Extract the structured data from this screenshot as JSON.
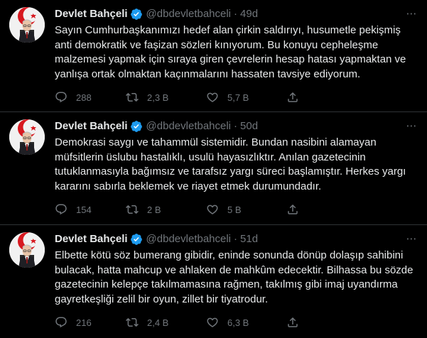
{
  "tweets": [
    {
      "name": "Devlet Bahçeli",
      "handle": "@dbdevletbahceli",
      "time": "49d",
      "text": "Sayın Cumhurbaşkanımızı hedef alan çirkin saldırıyı, husumetle pekişmiş\nanti demokratik ve faşizan sözleri kınıyorum. Bu konuyu cepheleşme\nmalzemesi yapmak için sıraya giren çevrelerin hesap hatası yapmaktan ve\nyanlışa ortak olmaktan kaçınmalarını hassaten tavsiye ediyorum.",
      "replies": "288",
      "retweets": "2,3 B",
      "likes": "5,7 B"
    },
    {
      "name": "Devlet Bahçeli",
      "handle": "@dbdevletbahceli",
      "time": "50d",
      "text": "Demokrasi saygı ve tahammül sistemidir. Bundan nasibini alamayan\nmüfsitlerin üslubu hastalıklı, usulü hayasızlıktır. Anılan gazetecinin\ntutuklanmasıyla bağımsız ve tarafsız yargı süreci başlamıştır. Herkes yargı\nkararını sabırla beklemek ve riayet etmek durumundadır.",
      "replies": "154",
      "retweets": "2 B",
      "likes": "5 B"
    },
    {
      "name": "Devlet Bahçeli",
      "handle": "@dbdevletbahceli",
      "time": "51d",
      "text": "Elbette kötü söz bumerang gibidir, eninde sonunda dönüp dolaşıp sahibini\nbulacak, hatta mahcup ve ahlaken de mahkûm edecektir. Bilhassa bu sözde\ngazetecinin kelepçe takılmamasına rağmen, takılmış gibi imaj uyandırma\ngayretkeşliği zelil bir oyun, zillet bir tiyatrodur.",
      "replies": "216",
      "retweets": "2,4 B",
      "likes": "6,3 B"
    }
  ],
  "separator": "·",
  "more_glyph": "⋯",
  "icons": {
    "reply": "reply-icon",
    "retweet": "retweet-icon",
    "like": "heart-icon",
    "share": "share-icon",
    "verified": "verified-badge-icon",
    "more": "more-options-icon"
  },
  "colors": {
    "background": "#000000",
    "text": "#e7e9ea",
    "secondary": "#71767b",
    "divider": "#2f3336",
    "verified": "#1d9bf0"
  }
}
